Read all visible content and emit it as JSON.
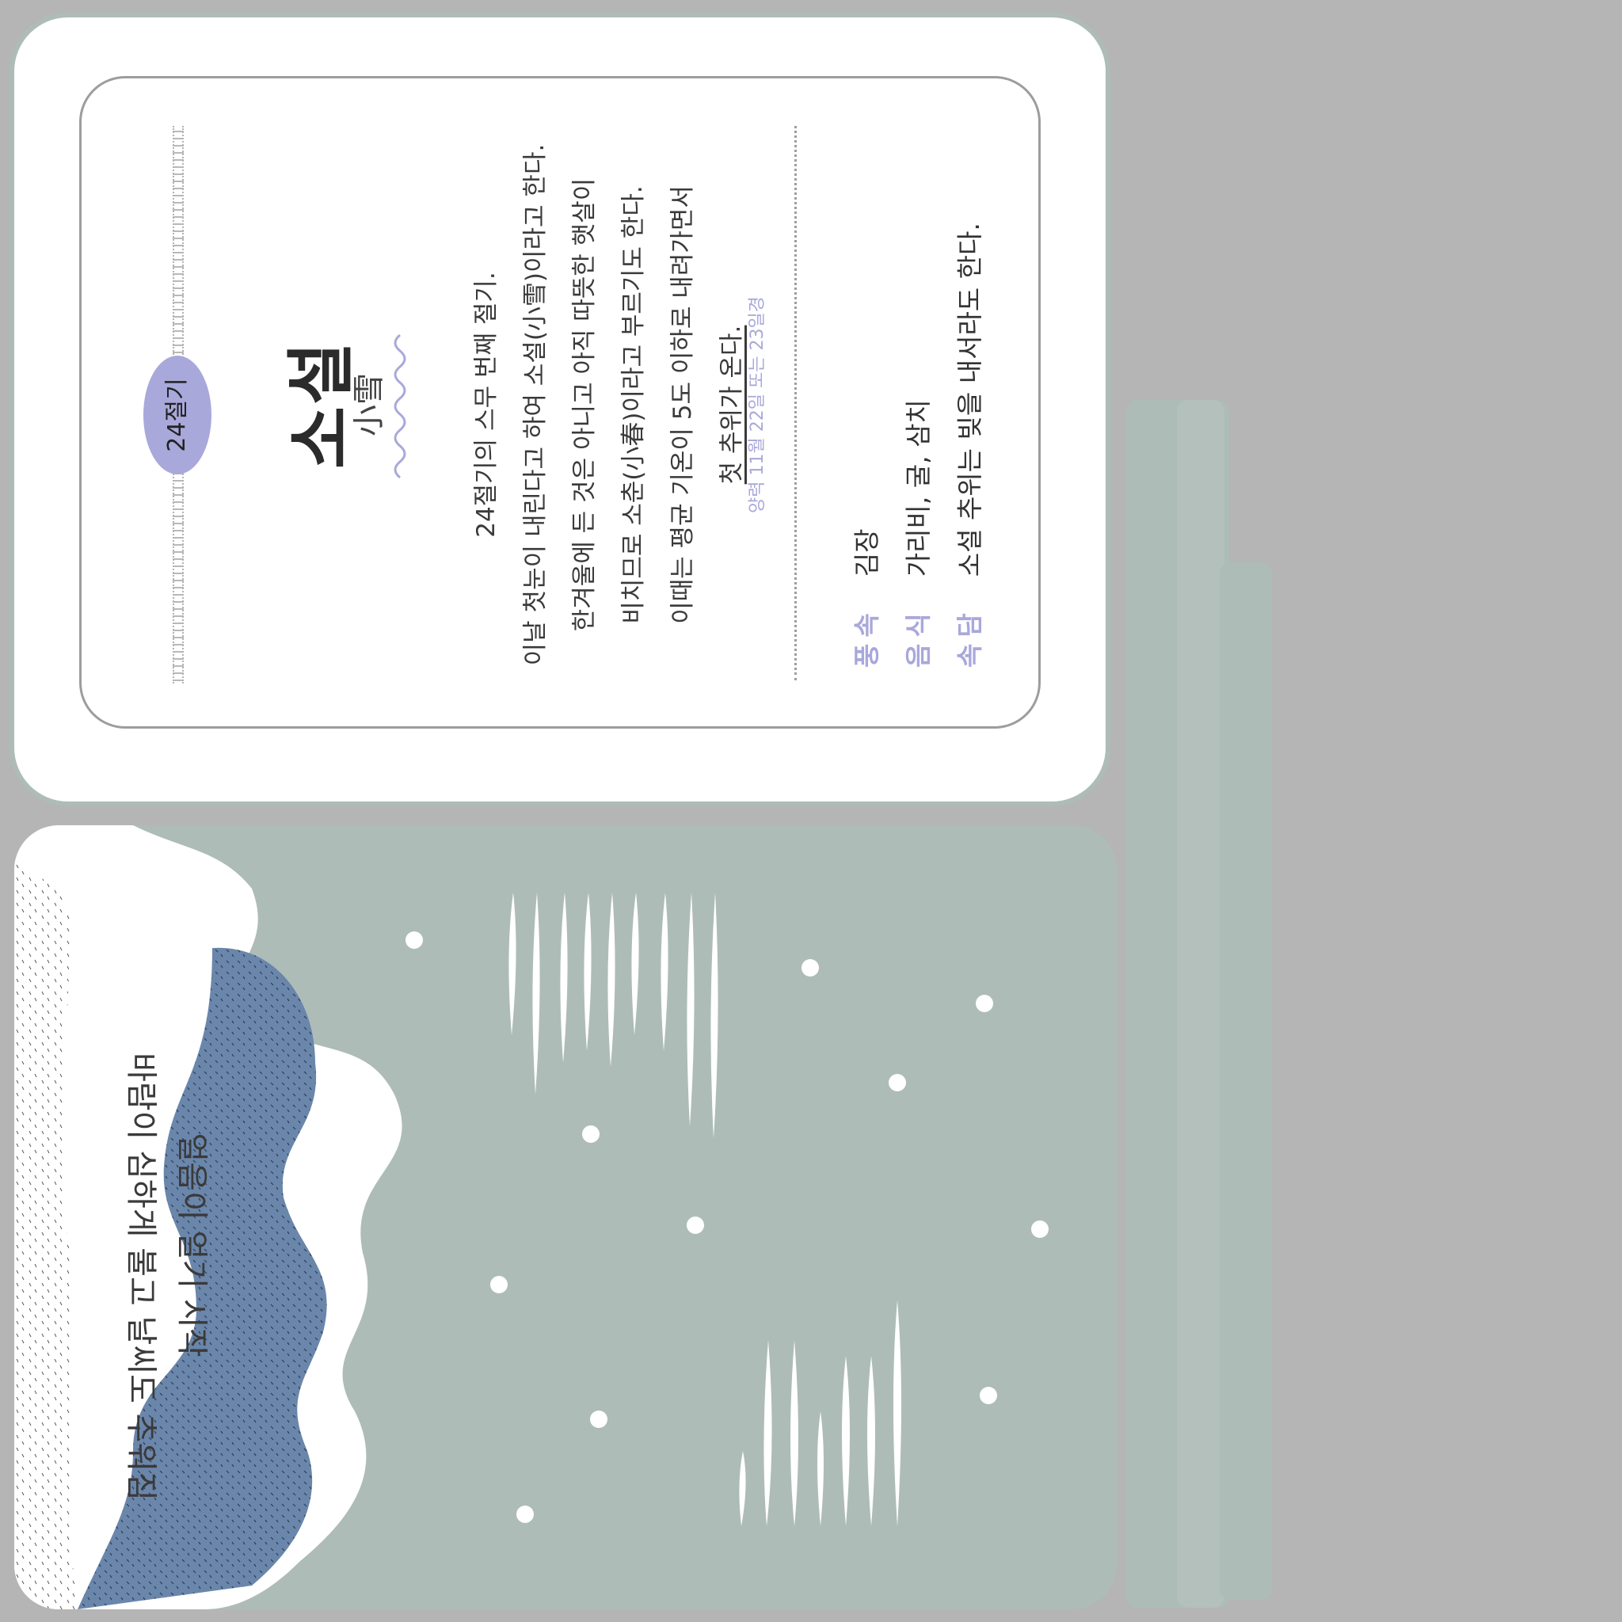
{
  "card": {
    "badge": "24절기",
    "title": "소설",
    "hanja": "小雪",
    "body_lines": [
      "24절기의 스무 번째 절기.",
      "이날 첫눈이 내린다고 하여 소설(小雪)이라고 한다.",
      "한겨울에 든 것은 아니고 아직 따뜻한 햇살이",
      "비치므로 소춘(小春)이라고 부르기도 한다.",
      "이때는 평균 기온이 5도 이하로 내려가면서",
      "첫 추위가 온다."
    ],
    "date": "양력 11월 22일 또는 23일경",
    "info": [
      {
        "label": "풍속",
        "value": "김장"
      },
      {
        "label": "음식",
        "value": "가리비, 굴, 삼치"
      },
      {
        "label": "속담",
        "value": "소설 추위는 빚을 내서라도 한다."
      }
    ]
  },
  "illustration": {
    "slogan_line1": "얼음이 얼기 시작",
    "slogan_line2": "바람이 심하게 불고 날씨도 추워짐"
  },
  "colors": {
    "background": "#b5b5b5",
    "card_green": "#aebcb8",
    "accent_lavender": "#a9a8db",
    "mountain_blue": "#6a86ab",
    "white": "#ffffff"
  }
}
